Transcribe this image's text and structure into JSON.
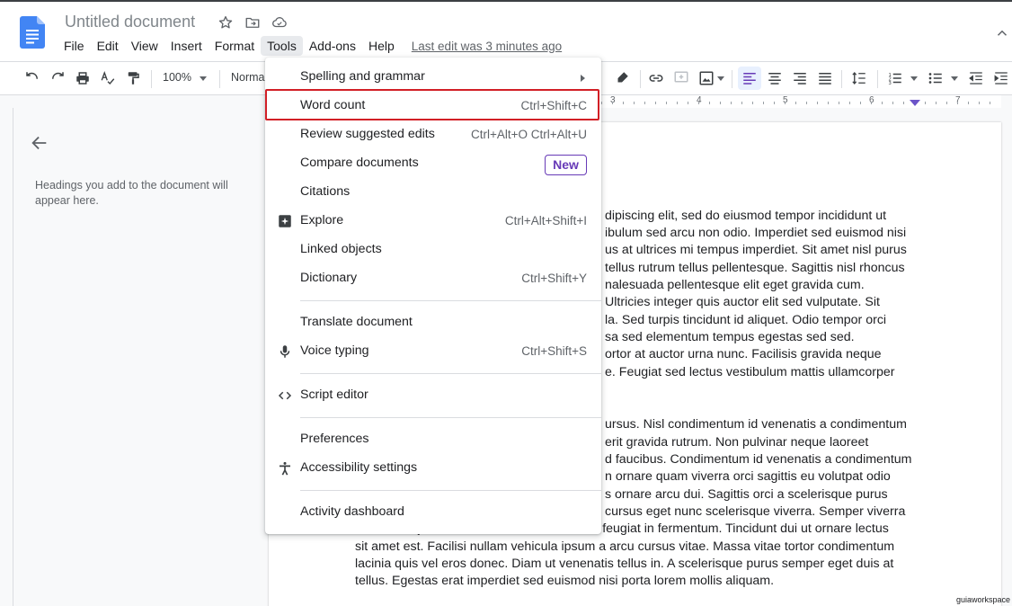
{
  "header": {
    "title": "Untitled document",
    "last_edit": "Last edit was 3 minutes ago"
  },
  "menubar": {
    "items": [
      "File",
      "Edit",
      "View",
      "Insert",
      "Format",
      "Tools",
      "Add-ons",
      "Help"
    ],
    "active": "Tools"
  },
  "toolbar": {
    "zoom": "100%",
    "style": "Normal",
    "accent_color": "#673ab7"
  },
  "ruler": {
    "numbers": [
      "3",
      "4",
      "5",
      "6",
      "7"
    ]
  },
  "outline": {
    "hint": "Headings you add to the document will appear here."
  },
  "tools_menu": {
    "items": [
      {
        "label": "Spelling and grammar",
        "shortcut": "",
        "has_submenu": true
      },
      {
        "label": "Word count",
        "shortcut": "Ctrl+Shift+C",
        "highlighted": true
      },
      {
        "label": "Review suggested edits",
        "shortcut": "Ctrl+Alt+O Ctrl+Alt+U"
      },
      {
        "label": "Compare documents",
        "badge": "New"
      },
      {
        "label": "Citations",
        "shortcut": ""
      },
      {
        "label": "Explore",
        "shortcut": "Ctrl+Alt+Shift+I",
        "icon": "explore-icon"
      },
      {
        "label": "Linked objects",
        "shortcut": ""
      },
      {
        "label": "Dictionary",
        "shortcut": "Ctrl+Shift+Y"
      },
      {
        "label": "Translate document",
        "shortcut": ""
      },
      {
        "label": "Voice typing",
        "shortcut": "Ctrl+Shift+S",
        "icon": "microphone-icon"
      },
      {
        "label": "Script editor",
        "shortcut": "",
        "icon": "code-icon"
      },
      {
        "label": "Preferences",
        "shortcut": ""
      },
      {
        "label": "Accessibility settings",
        "shortcut": "",
        "icon": "accessibility-icon"
      },
      {
        "label": "Activity dashboard",
        "shortcut": ""
      }
    ]
  },
  "document": {
    "lines": [
      "dipiscing elit, sed do eiusmod tempor incididunt ut",
      "ibulum sed arcu non odio. Imperdiet sed euismod nisi",
      "us at ultrices mi tempus imperdiet. Sit amet nisl purus",
      "tellus rutrum tellus pellentesque. Sagittis nisl rhoncus",
      "nalesuada pellentesque elit eget gravida cum.",
      "Ultricies integer quis auctor elit sed vulputate. Sit",
      "la. Sed turpis tincidunt id aliquet. Odio tempor orci",
      "sa sed elementum tempus egestas sed sed.",
      "ortor at auctor urna nunc. Facilisis gravida neque",
      "e. Feugiat sed lectus vestibulum mattis ullamcorper",
      "ursus. Nisl condimentum id venenatis a condimentum",
      "erit gravida rutrum. Non pulvinar neque laoreet",
      "d faucibus. Condimentum id venenatis a condimentum",
      "n ornare quam viverra orci sagittis eu volutpat odio",
      "s ornare arcu dui. Sagittis orci a scelerisque purus",
      "cursus eget nunc scelerisque viverra. Semper viverra",
      "nam libero justo laoreet sit amet. Risus nec feugiat in fermentum. Tincidunt dui ut ornare lectus",
      "sit amet est. Facilisi nullam vehicula ipsum a arcu cursus vitae. Massa vitae tortor condimentum",
      "lacinia quis vel eros donec. Diam ut venenatis tellus in. A scelerisque purus semper eget duis at",
      "tellus. Egestas erat imperdiet sed euismod nisi porta lorem mollis aliquam."
    ]
  },
  "watermark": "guiaworkspace"
}
